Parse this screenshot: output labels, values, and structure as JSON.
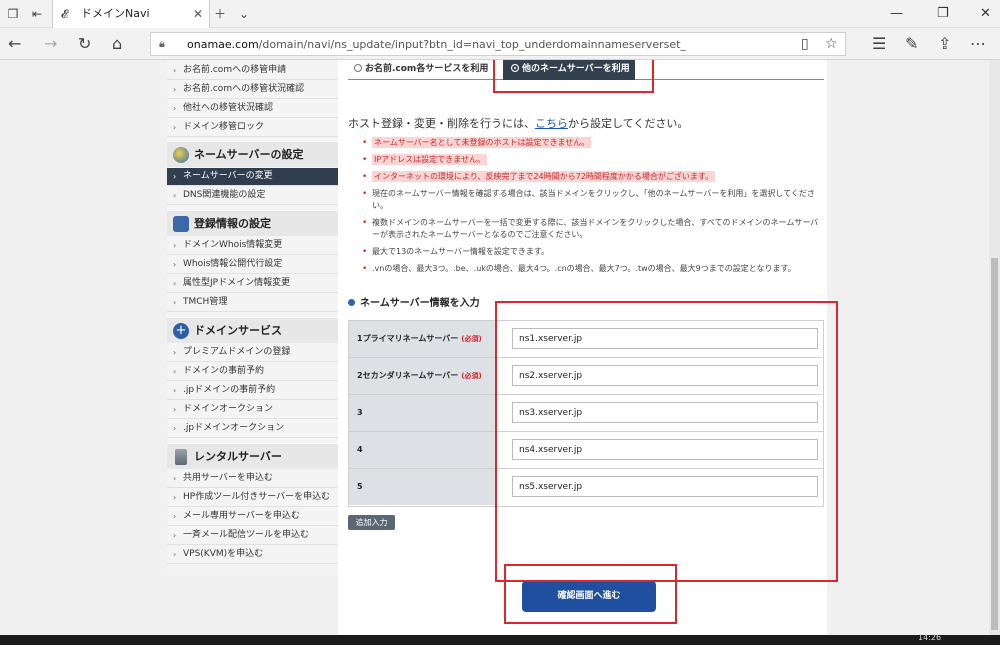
{
  "browser": {
    "tab_title": "ドメインNavi",
    "tab_icon": "bird-icon",
    "url_domain": "onamae.com",
    "url_path": "/domain/navi/ns_update/input?btn_id=navi_top_underdomainnameserverset_"
  },
  "sidebar": {
    "group_transfer": [
      "お名前.comへの移管申請",
      "お名前.comへの移管状況確認",
      "他社への移管状況確認",
      "ドメイン移管ロック"
    ],
    "ns_header": "ネームサーバーの設定",
    "group_ns": [
      "ネームサーバーの変更",
      "DNS関連機能の設定"
    ],
    "reg_header": "登録情報の設定",
    "group_reg": [
      "ドメインWhois情報変更",
      "Whois情報公開代行設定",
      "属性型JPドメイン情報変更",
      "TMCH管理"
    ],
    "domain_header": "ドメインサービス",
    "group_domain": [
      "プレミアムドメインの登録",
      "ドメインの事前予約",
      ".jpドメインの事前予約",
      "ドメインオークション",
      ".jpドメインオークション"
    ],
    "rental_header": "レンタルサーバー",
    "group_rental": [
      "共用サーバーを申込む",
      "HP作成ツール付きサーバーを申込む",
      "メール専用サーバーを申込む",
      "一斉メール配信ツールを申込む",
      "VPS(KVM)を申込む"
    ]
  },
  "main": {
    "radio_onamae": "お名前.com各サービスを利用",
    "radio_other": "他のネームサーバーを利用",
    "intro_before": "ホスト登録・変更・削除を行うには、",
    "intro_link": "こちら",
    "intro_after": "から設定してください。",
    "notes_highlight": [
      "ネームサーバー名として未登録のホストは設定できません。",
      "IPアドレスは設定できません。",
      "インターネットの環境により、反映完了まで24時間から72時間程度かかる場合がございます。"
    ],
    "notes": [
      "現在のネームサーバー情報を確認する場合は、該当ドメインをクリックし、「他のネームサーバーを利用」を選択してください。",
      "複数ドメインのネームサーバーを一括で変更する際に、該当ドメインをクリックした場合、すべてのドメインのネームサーバーが表示されたネームサーバーとなるのでご注意ください。",
      "最大で13のネームサーバー情報を設定できます。",
      ".vnの場合、最大3つ。.be、.ukの場合、最大4つ。.cnの場合、最大7つ。.twの場合、最大9つまでの設定となります。"
    ],
    "section_title": "ネームサーバー情報を入力",
    "required_label": "(必須)",
    "rows": [
      {
        "label": "1プライマリネームサーバー",
        "value": "ns1.xserver.jp"
      },
      {
        "label": "2セカンダリネームサーバー",
        "value": "ns2.xserver.jp"
      },
      {
        "label": "3",
        "value": "ns3.xserver.jp"
      },
      {
        "label": "4",
        "value": "ns4.xserver.jp"
      },
      {
        "label": "5",
        "value": "ns5.xserver.jp"
      }
    ],
    "add_button": "追加入力",
    "confirm_button": "確認画面へ進む"
  },
  "taskbar": {
    "time": "14:26"
  },
  "colors": {
    "highlight_border": "#e0262c",
    "primary_button": "#1f4f9e",
    "active_nav": "#313e4f"
  }
}
